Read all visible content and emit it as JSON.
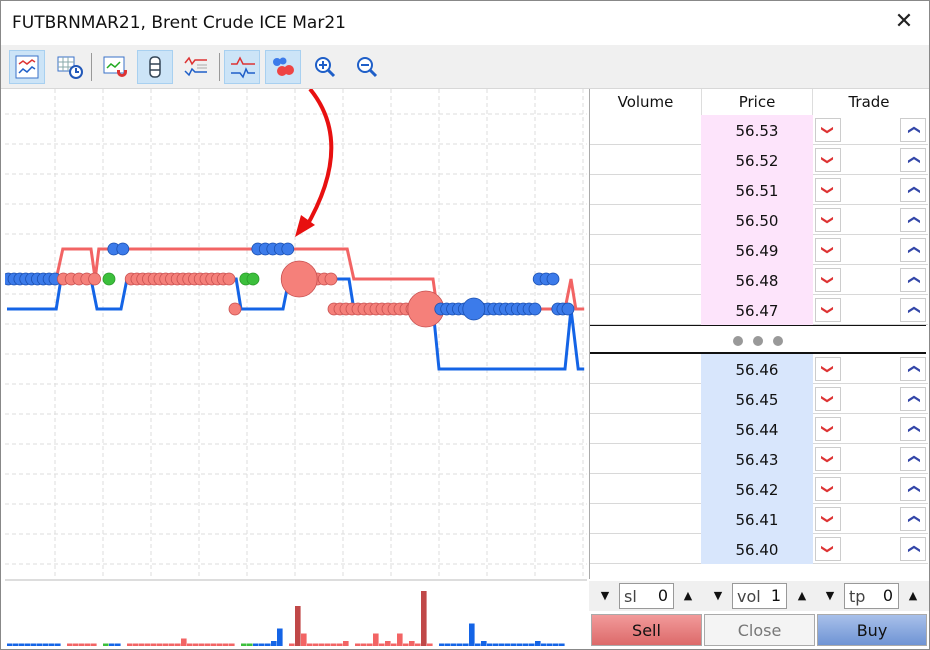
{
  "window": {
    "title": "FUTBRNMAR21, Brent Crude ICE Mar21",
    "close_icon": "close-icon"
  },
  "toolbar": [
    {
      "icon": "tick-chart-icon",
      "active": true
    },
    {
      "icon": "table-clock-icon",
      "active": false
    },
    {
      "icon": "chart-magnet-icon",
      "active": false
    },
    {
      "icon": "scrollbar-icon",
      "active": true
    },
    {
      "icon": "chart-list-icon",
      "active": false
    },
    {
      "icon": "bid-ask-lines-icon",
      "active": true
    },
    {
      "icon": "deals-bubbles-icon",
      "active": true
    },
    {
      "icon": "zoom-in-icon",
      "active": false
    },
    {
      "icon": "zoom-out-icon",
      "active": false
    }
  ],
  "colors": {
    "ask": "#f26464",
    "bid": "#1464e6",
    "ask_dot": "#f5807a",
    "bid_dot": "#3c7bea",
    "neutral_dot": "#3cbf3c",
    "volume_dark": "#c04848",
    "arrow": "#e81010",
    "sell": "#e87a7a",
    "buy": "#7aa0d8"
  },
  "chart_data": {
    "type": "line",
    "y_unit": "price",
    "series": [
      {
        "side": "ask",
        "points": [
          [
            1,
            56.48
          ],
          [
            9.2,
            56.48
          ],
          [
            10.3,
            56.49
          ],
          [
            15,
            56.49
          ],
          [
            15.7,
            56.48
          ],
          [
            16.3,
            56.49
          ],
          [
            57.7,
            56.49
          ],
          [
            58.8,
            56.48
          ],
          [
            72,
            56.48
          ],
          [
            72.7,
            56.47
          ],
          [
            94,
            56.47
          ],
          [
            95,
            56.48
          ],
          [
            95.8,
            56.47
          ],
          [
            97.2,
            56.47
          ]
        ]
      },
      {
        "side": "bid",
        "points": [
          [
            1,
            56.47
          ],
          [
            9.2,
            56.47
          ],
          [
            10,
            56.48
          ],
          [
            15,
            56.48
          ],
          [
            16,
            56.47
          ],
          [
            20,
            56.47
          ],
          [
            21,
            56.48
          ],
          [
            39.2,
            56.48
          ],
          [
            40,
            56.47
          ],
          [
            47,
            56.47
          ],
          [
            48,
            56.48
          ],
          [
            58,
            56.48
          ],
          [
            58.8,
            56.47
          ],
          [
            72,
            56.47
          ],
          [
            73,
            56.45
          ],
          [
            94,
            56.45
          ],
          [
            95,
            56.47
          ],
          [
            96.2,
            56.45
          ],
          [
            97.2,
            56.45
          ]
        ]
      }
    ],
    "deals": [
      {
        "side": "bid",
        "price": 56.48,
        "from": 1.2,
        "to": 9,
        "count": 9,
        "size": 1
      },
      {
        "side": "ask",
        "price": 56.48,
        "from": 10.4,
        "to": 15.6,
        "count": 5,
        "size": 1
      },
      {
        "side": "neutral",
        "price": 56.48,
        "from": 18,
        "to": 18,
        "count": 1,
        "size": 1
      },
      {
        "side": "bid",
        "price": 56.49,
        "from": 18.8,
        "to": 20.3,
        "count": 2,
        "size": 1
      },
      {
        "side": "ask",
        "price": 56.48,
        "from": 21.7,
        "to": 38,
        "count": 18,
        "size": 1
      },
      {
        "side": "ask",
        "price": 56.47,
        "from": 39,
        "to": 39,
        "count": 1,
        "size": 1
      },
      {
        "side": "neutral",
        "price": 56.48,
        "from": 40.8,
        "to": 42,
        "count": 2,
        "size": 1
      },
      {
        "side": "bid",
        "price": 56.49,
        "from": 42.8,
        "to": 47.8,
        "count": 5,
        "size": 1
      },
      {
        "side": "ask",
        "price": 56.48,
        "from": 50.5,
        "to": 55,
        "count": 5,
        "size": 1
      },
      {
        "side": "ask",
        "price": 56.48,
        "from": 49.7,
        "to": 49.7,
        "count": 1,
        "size": 3
      },
      {
        "side": "ask",
        "price": 56.47,
        "from": 55.5,
        "to": 68.5,
        "count": 14,
        "size": 1
      },
      {
        "side": "ask",
        "price": 56.47,
        "from": 70.8,
        "to": 70.8,
        "count": 1,
        "size": 3
      },
      {
        "side": "bid",
        "price": 56.47,
        "from": 73.3,
        "to": 89,
        "count": 17,
        "size": 1
      },
      {
        "side": "bid",
        "price": 56.47,
        "from": 78.8,
        "to": 78.8,
        "count": 1,
        "size": 2
      },
      {
        "side": "bid",
        "price": 56.48,
        "from": 89.7,
        "to": 92,
        "count": 3,
        "size": 1
      },
      {
        "side": "bid",
        "price": 56.47,
        "from": 92.8,
        "to": 94.5,
        "count": 3,
        "size": 1
      }
    ],
    "volumes": [
      [
        "b",
        1
      ],
      [
        "b",
        1
      ],
      [
        "b",
        1
      ],
      [
        "b",
        1
      ],
      [
        "b",
        1
      ],
      [
        "b",
        1
      ],
      [
        "b",
        1
      ],
      [
        "b",
        1
      ],
      [
        "b",
        1
      ],
      [
        null,
        0
      ],
      [
        "a",
        1
      ],
      [
        "a",
        1
      ],
      [
        "a",
        1
      ],
      [
        "a",
        1
      ],
      [
        "a",
        1
      ],
      [
        null,
        0
      ],
      [
        "n",
        1
      ],
      [
        "b",
        1
      ],
      [
        "b",
        1
      ],
      [
        null,
        0
      ],
      [
        "a",
        1
      ],
      [
        "a",
        1
      ],
      [
        "a",
        1
      ],
      [
        "a",
        1
      ],
      [
        "a",
        1
      ],
      [
        "a",
        1
      ],
      [
        "a",
        1
      ],
      [
        "a",
        1
      ],
      [
        "a",
        1
      ],
      [
        "a",
        3
      ],
      [
        "a",
        1
      ],
      [
        "a",
        1
      ],
      [
        "a",
        1
      ],
      [
        "a",
        1
      ],
      [
        "a",
        1
      ],
      [
        "a",
        1
      ],
      [
        "a",
        1
      ],
      [
        "a",
        1
      ],
      [
        null,
        0
      ],
      [
        "n",
        1
      ],
      [
        "n",
        1
      ],
      [
        "b",
        1
      ],
      [
        "b",
        1
      ],
      [
        "b",
        1
      ],
      [
        "b",
        2
      ],
      [
        "b",
        7
      ],
      [
        null,
        0
      ],
      [
        "a",
        1
      ],
      [
        "d",
        16
      ],
      [
        "a",
        5
      ],
      [
        "a",
        1
      ],
      [
        "a",
        1
      ],
      [
        "a",
        1
      ],
      [
        "a",
        1
      ],
      [
        "a",
        1
      ],
      [
        "a",
        1
      ],
      [
        "a",
        2
      ],
      [
        null,
        0
      ],
      [
        "a",
        1
      ],
      [
        "a",
        1
      ],
      [
        "a",
        1
      ],
      [
        "a",
        5
      ],
      [
        "a",
        1
      ],
      [
        "a",
        2
      ],
      [
        "a",
        1
      ],
      [
        "a",
        5
      ],
      [
        "a",
        1
      ],
      [
        "a",
        2
      ],
      [
        "a",
        1
      ],
      [
        "d",
        22
      ],
      [
        "a",
        1
      ],
      [
        null,
        0
      ],
      [
        "b",
        1
      ],
      [
        "b",
        1
      ],
      [
        "b",
        1
      ],
      [
        "b",
        1
      ],
      [
        "b",
        1
      ],
      [
        "b",
        9
      ],
      [
        "b",
        1
      ],
      [
        "b",
        2
      ],
      [
        "b",
        1
      ],
      [
        "b",
        1
      ],
      [
        "b",
        1
      ],
      [
        "b",
        1
      ],
      [
        "b",
        1
      ],
      [
        "b",
        1
      ],
      [
        "b",
        1
      ],
      [
        "b",
        1
      ],
      [
        "b",
        2
      ],
      [
        "b",
        1
      ],
      [
        "b",
        1
      ],
      [
        "b",
        1
      ],
      [
        "b",
        1
      ]
    ]
  },
  "book": {
    "headers": {
      "volume": "Volume",
      "price": "Price",
      "trade": "Trade"
    },
    "asks": [
      "56.53",
      "56.52",
      "56.51",
      "56.50",
      "56.49",
      "56.48",
      "56.47"
    ],
    "bids": [
      "56.46",
      "56.45",
      "56.44",
      "56.43",
      "56.42",
      "56.41",
      "56.40"
    ],
    "sell_icon": "chevron-down-icon",
    "buy_icon": "chevron-up-icon"
  },
  "controls": {
    "sl": {
      "label": "sl",
      "value": "0"
    },
    "vol": {
      "label": "vol",
      "value": "1"
    },
    "tp": {
      "label": "tp",
      "value": "0"
    },
    "sell": "Sell",
    "close": "Close",
    "buy": "Buy"
  }
}
